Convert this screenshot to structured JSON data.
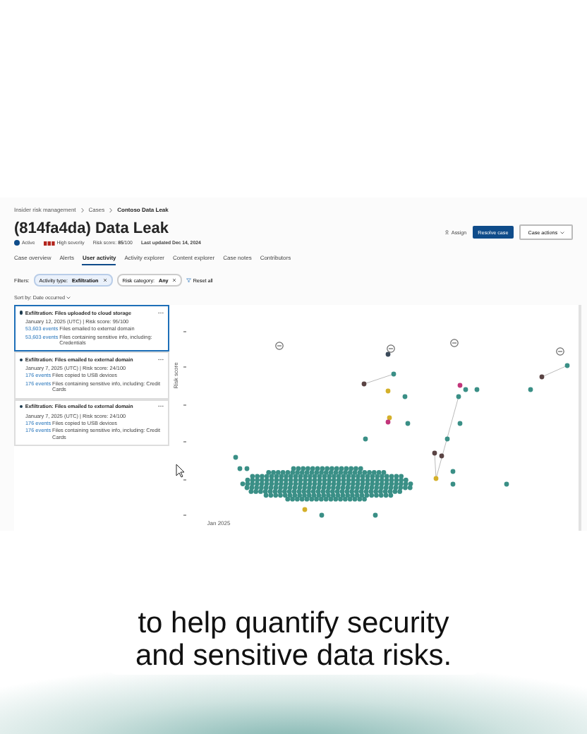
{
  "breadcrumbs": [
    "Insider risk management",
    "Cases",
    "Contoso Data Leak"
  ],
  "case": {
    "title": "(814fa4da) Data Leak",
    "status": "Active",
    "severity": "High severity",
    "risk_score": "Risk score: **85**/100",
    "last_updated": "Last updated Dec 14, 2024"
  },
  "actions": {
    "assign": "Assign",
    "resolve": "Resolve case",
    "case_actions": "Case actions"
  },
  "tabs": [
    {
      "label": "Case overview",
      "selected": false
    },
    {
      "label": "Alerts",
      "selected": false
    },
    {
      "label": "User activity",
      "selected": true
    },
    {
      "label": "Activity explorer",
      "selected": false
    },
    {
      "label": "Content explorer",
      "selected": false
    },
    {
      "label": "Case notes",
      "selected": false
    },
    {
      "label": "Contributors",
      "selected": false
    }
  ],
  "filters": {
    "label": "Filters:",
    "chips": [
      {
        "text": "Activity type: **Exfiltration**"
      },
      {
        "text": "Risk category: **Any**"
      }
    ],
    "reset": "Reset all"
  },
  "sort": "Sort by: Date occurred",
  "activities": [
    {
      "title": "Exfiltration: Files uploaded to cloud storage",
      "meta": "January 12, 2025 (UTC)  |  Risk score: 95/100",
      "selected": true,
      "events": [
        {
          "count": "53,603 events",
          "text": "Files emailed to external domain"
        },
        {
          "count": "53,603 events",
          "text": "Files containing sensitive info, including: Credentials"
        }
      ]
    },
    {
      "title": "Exfiltration: Files emailed to external domain",
      "meta": "January 7, 2025 (UTC)  |  Risk score: 24/100",
      "selected": false,
      "events": [
        {
          "count": "176 events",
          "text": "Files copied to USB devices"
        },
        {
          "count": "176 events",
          "text": "Files containing sensitive info, including: Credit Cards"
        }
      ]
    },
    {
      "title": "Exfiltration: Files emailed to external domain",
      "meta": "January 7, 2025 (UTC)  |  Risk score: 24/100",
      "selected": false,
      "events": [
        {
          "count": "176 events",
          "text": "Files copied to USB devices"
        },
        {
          "count": "176 events",
          "text": "Files containing sensitive info, including: Credit Cards"
        }
      ]
    }
  ],
  "chart": {
    "ylabel": "Risk score",
    "xlabel": "Jan 2025"
  },
  "caption": "to help quantify security and sensitive data risks."
}
